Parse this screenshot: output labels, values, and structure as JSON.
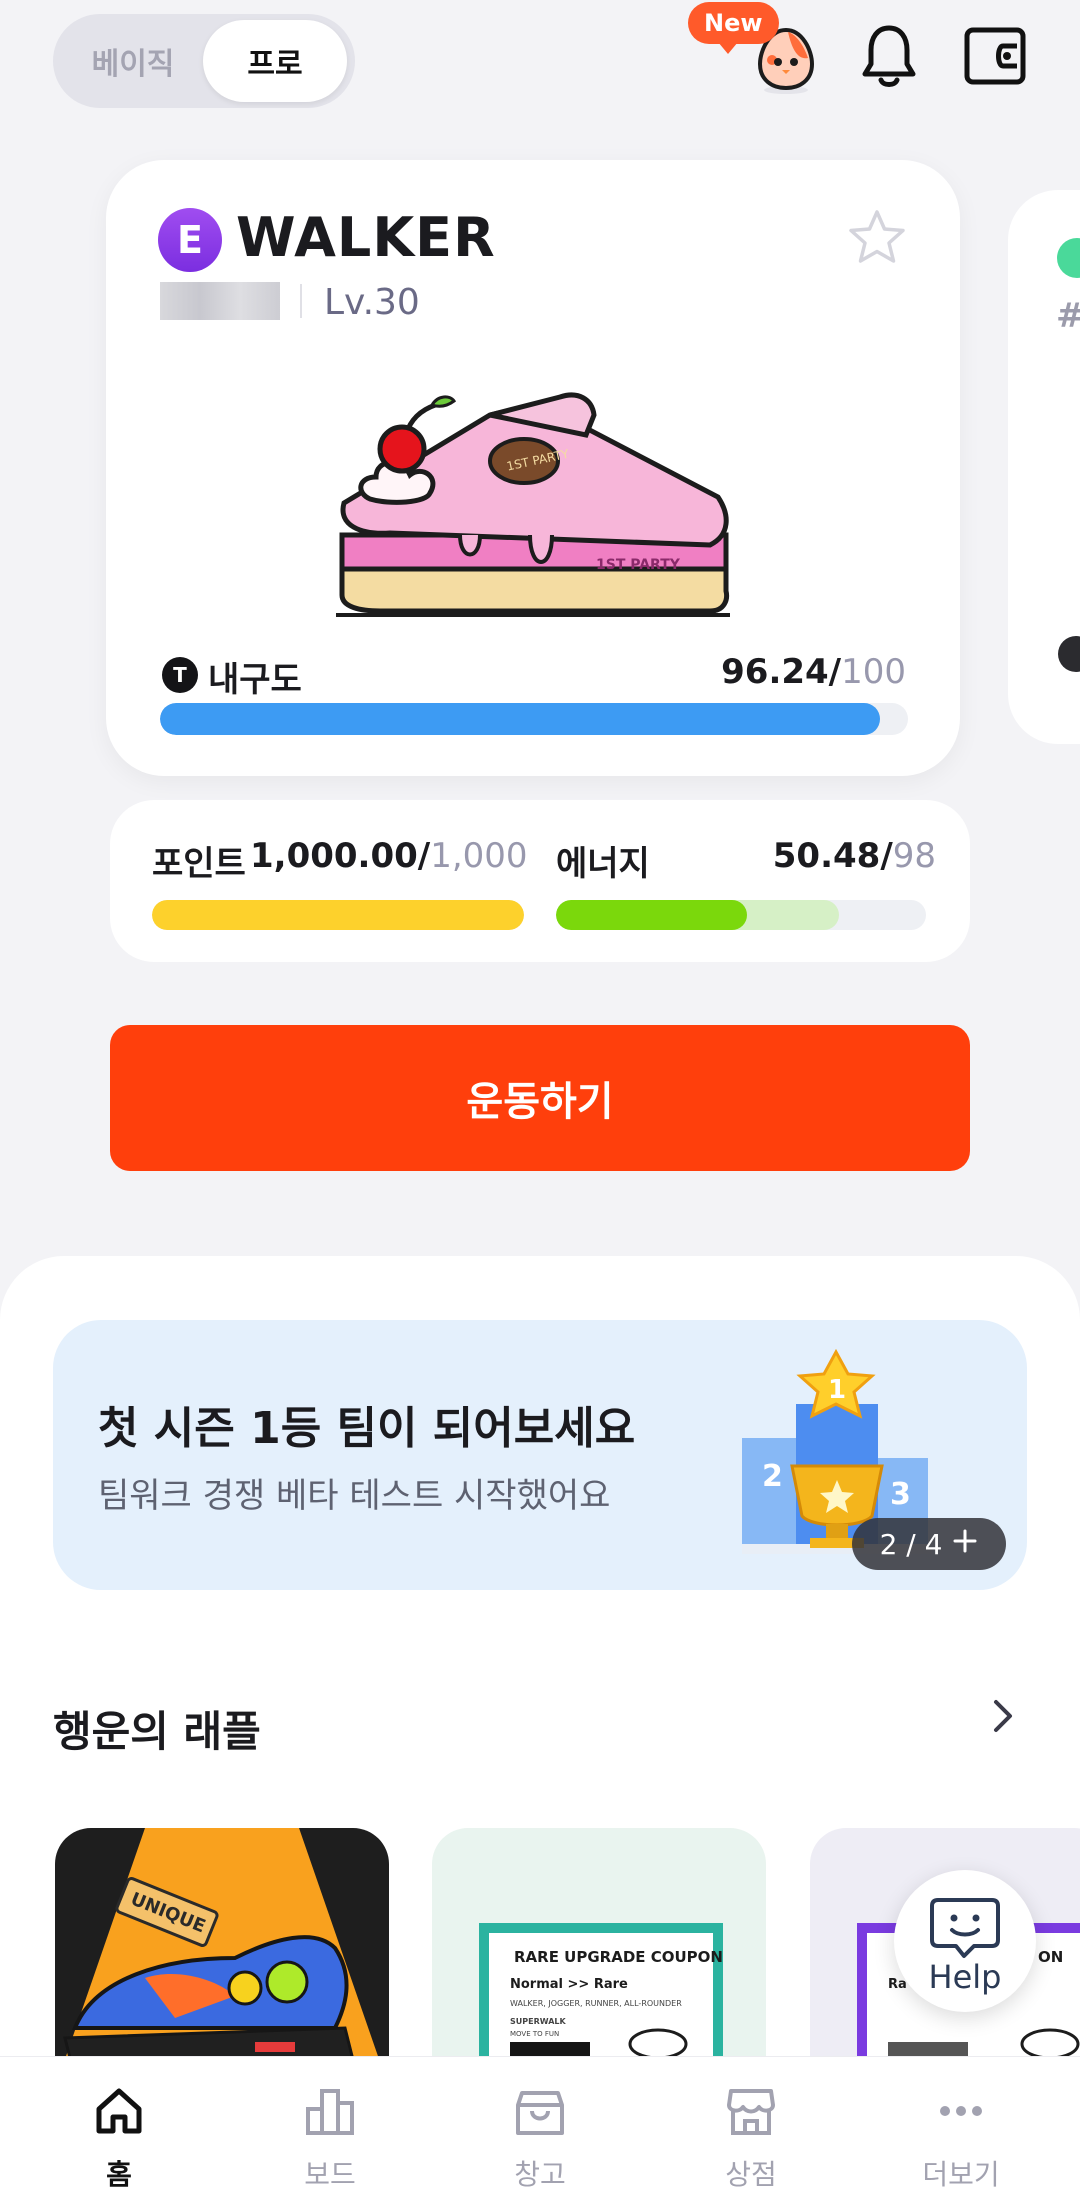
{
  "mode_toggle": {
    "basic": "베이직",
    "pro": "프로",
    "selected": "프로"
  },
  "top_icons": {
    "egg": "egg-character-icon",
    "new_badge": "New",
    "bell": "bell-icon",
    "wallet": "wallet-icon"
  },
  "nft_card": {
    "class_badge": "E",
    "class_name": "WALKER",
    "level": "Lv.30",
    "durability": {
      "label": "내구도",
      "icon": "T",
      "value": "96.24",
      "max": "100",
      "fraction": 0.9624
    },
    "colors": {
      "durability_bar": "#3d9bf3",
      "class_badge": "#8a3de8"
    }
  },
  "stats": {
    "points": {
      "label": "포인트",
      "value": "1,000.00",
      "max": "1,000",
      "fraction": 1.0
    },
    "energy": {
      "label": "에너지",
      "value": "50.48",
      "max": "98",
      "fraction": 0.515,
      "capacity_fraction": 0.765
    },
    "colors": {
      "points_bar": "#fdd12c",
      "energy_bar": "#7bd80c",
      "energy_capacity": "#d6f0c6"
    }
  },
  "exercise_button": {
    "label": "운동하기",
    "color": "#ff3f0c"
  },
  "banner": {
    "title": "첫 시즌 1등 팀이 되어보세요",
    "subtitle": "팀워크 경쟁 베타 테스트 시작했어요",
    "pager": "2 / 4",
    "pager_icon": "plus-icon",
    "podium": {
      "first": "1",
      "second": "2",
      "third": "3"
    }
  },
  "raffle": {
    "title": "행운의 래플",
    "items": [
      {
        "tag": "UNIQUE"
      },
      {
        "coupon_title": "RARE UPGRADE COUPON",
        "coupon_line": "Normal >> Rare",
        "coupon_desc": "WALKER, JOGGER, RUNNER, ALL-ROUNDER",
        "brand": "SUPERWALK",
        "slogan": "MOVE TO FUN"
      },
      {
        "coupon_title": "ON",
        "coupon_line": "Ra"
      }
    ]
  },
  "help": {
    "label": "Help"
  },
  "bottom_nav": [
    {
      "label": "홈",
      "icon": "home-icon",
      "active": true
    },
    {
      "label": "보드",
      "icon": "chart-icon",
      "active": false
    },
    {
      "label": "창고",
      "icon": "box-icon",
      "active": false
    },
    {
      "label": "상점",
      "icon": "store-icon",
      "active": false
    },
    {
      "label": "더보기",
      "icon": "more-icon",
      "active": false
    }
  ]
}
